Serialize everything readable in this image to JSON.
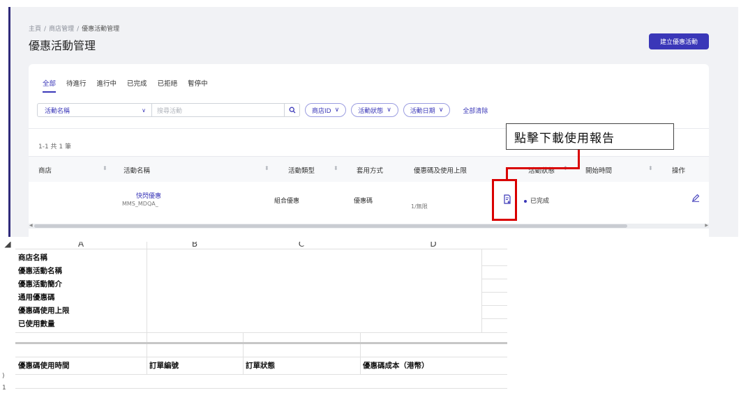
{
  "breadcrumb": {
    "home": "主頁",
    "shop": "商店管理",
    "current": "優惠活動管理",
    "separator": "/"
  },
  "page_title": "優惠活動管理",
  "create_button": "建立優惠活動",
  "tabs": [
    "全部",
    "待進行",
    "進行中",
    "已完成",
    "已拒絕",
    "暫停中"
  ],
  "filters": {
    "field_select": "活動名稱",
    "search_placeholder": "搜尋活動",
    "pills": [
      "商店ID",
      "活動狀態",
      "活動日期"
    ],
    "clear_all": "全部清除"
  },
  "result_count": "1-1 共 1 筆",
  "table": {
    "columns": [
      "商店",
      "活動名稱",
      "活動類型",
      "套用方式",
      "優惠碼及使用上限",
      "活動狀態",
      "開始時間",
      "操作"
    ],
    "rows": [
      {
        "name": "快閃優惠",
        "code": "MMS_MDQA_",
        "type": "組合優惠",
        "apply": "優惠碼",
        "limit": "1/無限",
        "status": "已完成"
      }
    ]
  },
  "callout": "點擊下載使用報告",
  "sheet": {
    "col_headers": [
      "A",
      "B",
      "C",
      "D"
    ],
    "rows_top": [
      "商店名稱",
      "優惠活動名稱",
      "優惠活動簡介",
      "通用優惠碼",
      "優惠碼使用上限",
      "已使用數量"
    ],
    "headers_bottom": [
      "優惠碼使用時間",
      "訂單編號",
      "訂單狀態",
      "優惠碼成本（港幣）"
    ],
    "row_numbers": [
      ")",
      "1"
    ]
  },
  "colors": {
    "accent": "#3a37b8",
    "highlight": "#d90000"
  },
  "icons": [
    "chevron-down-icon",
    "search-icon",
    "download-report-icon",
    "edit-pencil-icon"
  ]
}
